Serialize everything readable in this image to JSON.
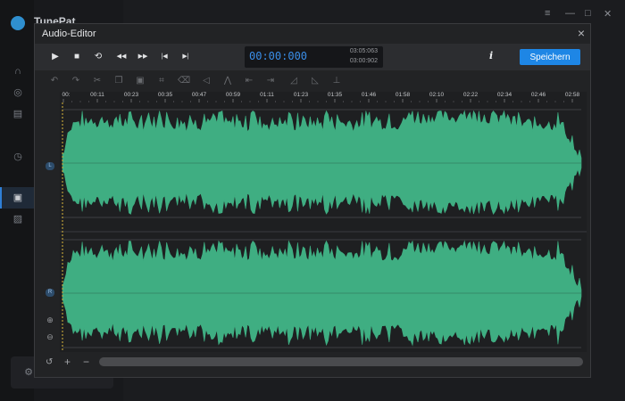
{
  "app": {
    "title": "TunePat"
  },
  "dialog": {
    "title": "Audio-Editor",
    "close_icon": "×"
  },
  "toolbar": {
    "play_icon": "▶",
    "stop_icon": "■",
    "loop_icon": "⟲",
    "rewind_icon": "◀◀",
    "forward_icon": "▶▶",
    "prev_icon": "|◀",
    "next_icon": "▶|",
    "current_time": "00:00:000",
    "total_time": "03:05:063",
    "selection_time": "03:00:902",
    "info_label": "i",
    "save_label": "Speichern"
  },
  "ruler": {
    "ticks": [
      "00:",
      "00:11",
      "00:23",
      "00:35",
      "00:47",
      "00:59",
      "01:11",
      "01:23",
      "01:35",
      "01:46",
      "01:58",
      "02:10",
      "02:22",
      "02:34",
      "02:46",
      "02:58"
    ]
  },
  "channels": {
    "left_label": "L",
    "right_label": "R"
  },
  "colors": {
    "waveform": "#3fae82",
    "accent": "#1e86e5",
    "time": "#3a8ee8"
  }
}
